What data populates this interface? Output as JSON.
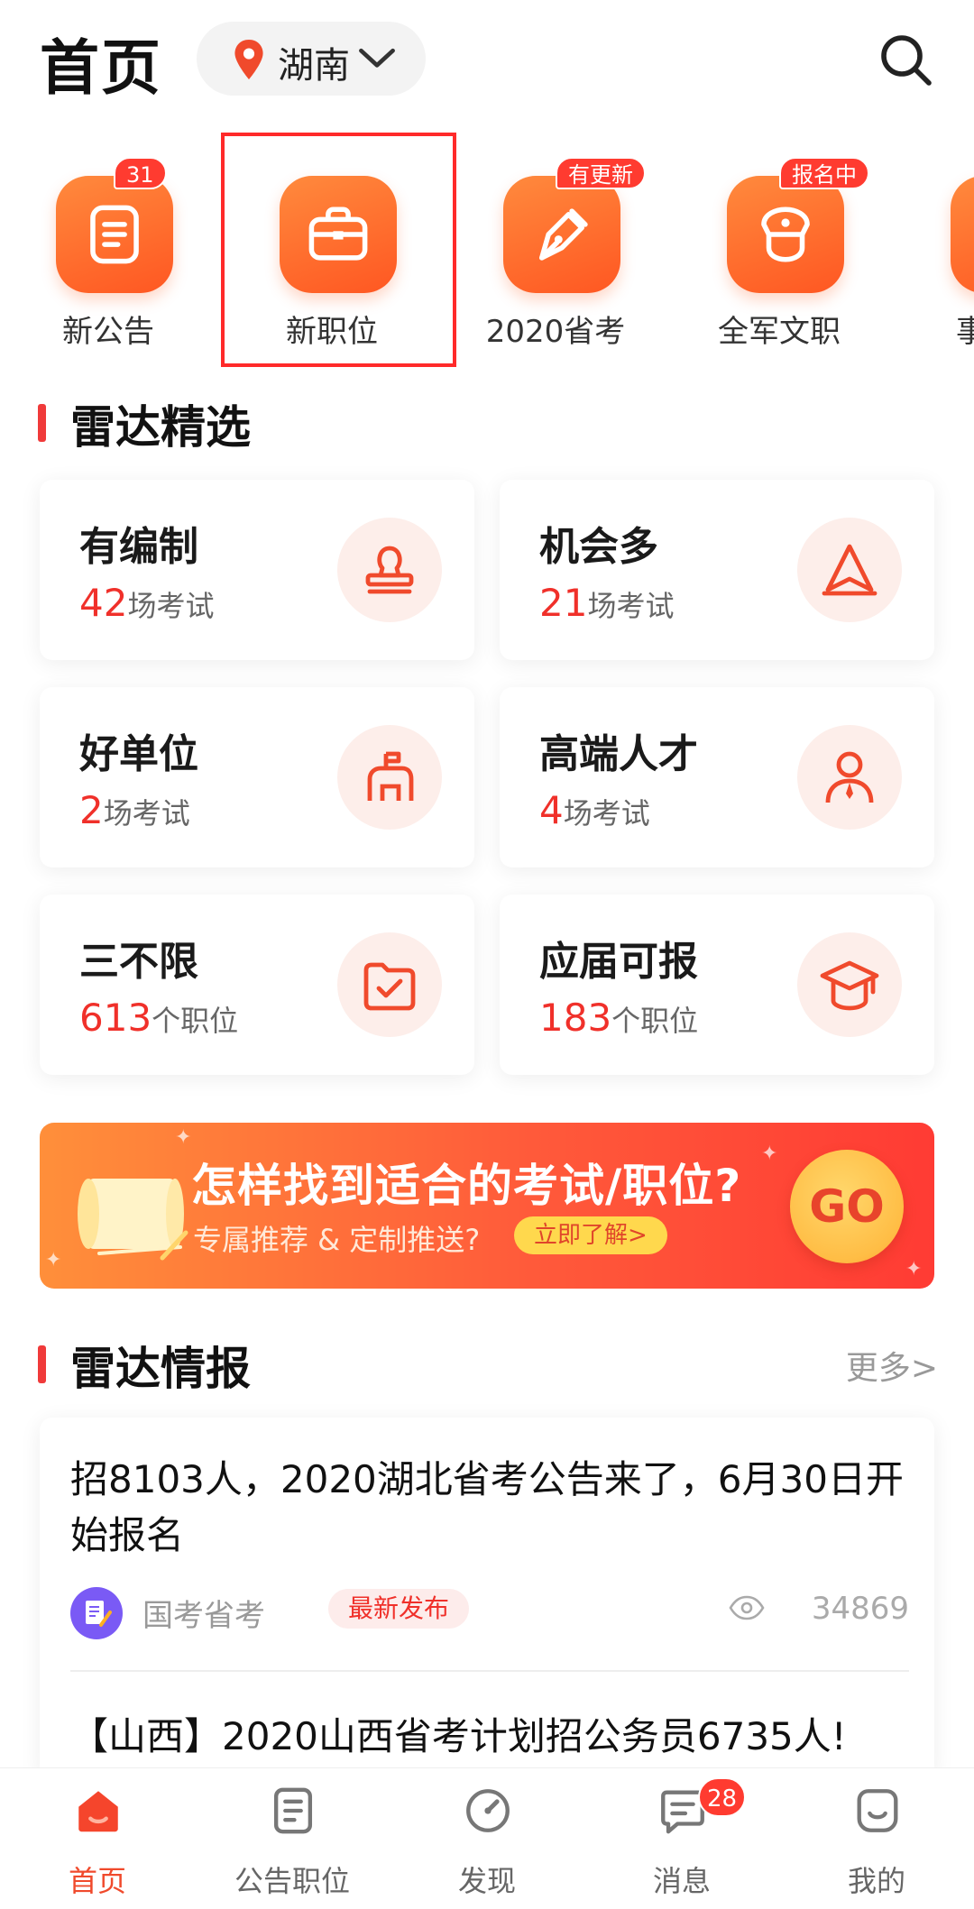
{
  "header": {
    "title": "首页",
    "location": "湖南"
  },
  "quick_icons": [
    {
      "label": "新公告",
      "badge": "31",
      "icon": "document-icon"
    },
    {
      "label": "新职位",
      "badge": "",
      "icon": "briefcase-icon"
    },
    {
      "label": "2020省考",
      "badge": "有更新",
      "icon": "pen-nib-icon"
    },
    {
      "label": "全军文职",
      "badge": "报名中",
      "icon": "military-cap-icon"
    },
    {
      "label": "事业",
      "badge": "",
      "icon": "institution-icon"
    }
  ],
  "radar_select": {
    "title": "雷达精选",
    "cards": [
      {
        "title": "有编制",
        "count": "42",
        "unit": "场考试",
        "icon": "stamp-icon"
      },
      {
        "title": "机会多",
        "count": "21",
        "unit": "场考试",
        "icon": "navigation-arrow-icon"
      },
      {
        "title": "好单位",
        "count": "2",
        "unit": "场考试",
        "icon": "mailbox-icon"
      },
      {
        "title": "高端人才",
        "count": "4",
        "unit": "场考试",
        "icon": "person-tie-icon"
      },
      {
        "title": "三不限",
        "count": "613",
        "unit": "个职位",
        "icon": "folder-check-icon"
      },
      {
        "title": "应届可报",
        "count": "183",
        "unit": "个职位",
        "icon": "graduation-cap-icon"
      }
    ]
  },
  "banner": {
    "title": "怎样找到适合的考试/职位?",
    "subtitle": "专属推荐 & 定制推送?",
    "cta": "立即了解>",
    "go": "GO"
  },
  "radar_news": {
    "title": "雷达情报",
    "more": "更多>",
    "items": [
      {
        "title": "招8103人，2020湖北省考公告来了，6月30日开始报名",
        "source": "国考省考",
        "tag": "最新发布",
        "views": "34869"
      },
      {
        "title": "【山西】2020山西省考计划招公务员6735人!"
      }
    ]
  },
  "tabbar": {
    "tabs": [
      {
        "label": "首页",
        "icon": "home-icon",
        "active": true,
        "badge": ""
      },
      {
        "label": "公告职位",
        "icon": "document-list-icon",
        "active": false,
        "badge": ""
      },
      {
        "label": "发现",
        "icon": "compass-icon",
        "active": false,
        "badge": ""
      },
      {
        "label": "消息",
        "icon": "message-icon",
        "active": false,
        "badge": "28"
      },
      {
        "label": "我的",
        "icon": "smiley-icon",
        "active": false,
        "badge": ""
      }
    ]
  },
  "colors": {
    "accent": "#f0302a",
    "orange": "#ff6a2c"
  }
}
